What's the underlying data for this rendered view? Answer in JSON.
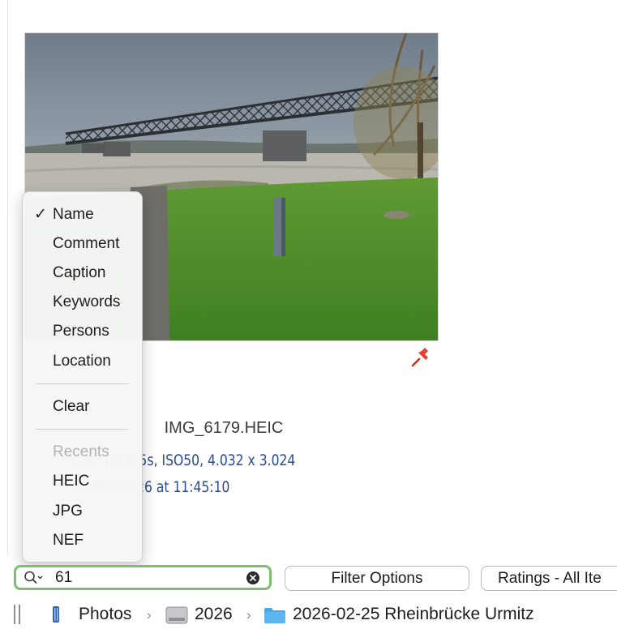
{
  "photo": {
    "filename": "IMG_6179.HEIC",
    "exif_line": "…m, 1/1325s, ISO50, 4.032 x 3.024",
    "date_line": "25. Feb 2026 at 11:45:10",
    "pin_color": "#e5432f"
  },
  "search_menu": {
    "items": [
      {
        "label": "Name",
        "checked": true
      },
      {
        "label": "Comment",
        "checked": false
      },
      {
        "label": "Caption",
        "checked": false
      },
      {
        "label": "Keywords",
        "checked": false
      },
      {
        "label": "Persons",
        "checked": false
      },
      {
        "label": "Location",
        "checked": false
      }
    ],
    "checkmark": "✓",
    "clear_label": "Clear",
    "recents_header": "Recents",
    "recents": [
      "HEIC",
      "JPG",
      "NEF"
    ]
  },
  "search": {
    "value": "61",
    "icon": "magnifier-icon",
    "accent_color": "#7ac16a"
  },
  "toolbar": {
    "filter_label": "Filter Options",
    "ratings_label": "Ratings - All Ite"
  },
  "path": {
    "separator": "›",
    "crumbs": [
      {
        "label": "Photos",
        "icon": "photos-app-icon"
      },
      {
        "label": "2026",
        "icon": "disk-icon"
      },
      {
        "label": "2026-02-25 Rheinbrücke Urmitz",
        "icon": "folder-icon"
      }
    ]
  }
}
